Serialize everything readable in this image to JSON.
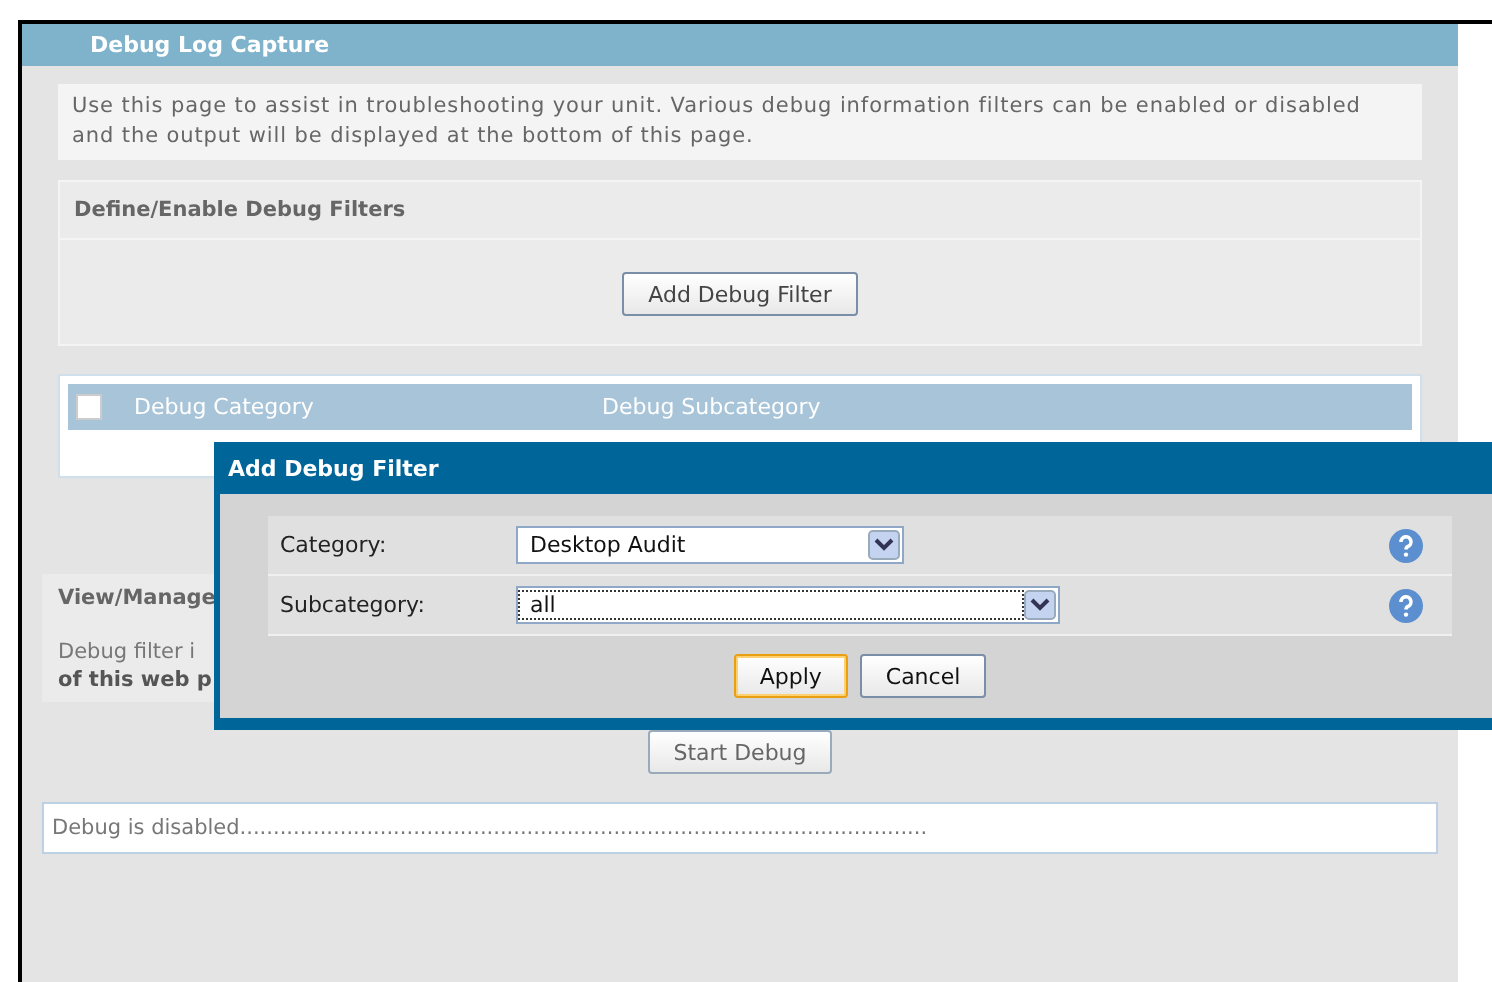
{
  "page_title": "Debug Log Capture",
  "intro": "Use this page to assist in troubleshooting your unit. Various debug information filters can be enabled or disabled and the output will be displayed at the bottom of this page.",
  "filters_section": {
    "title": "Define/Enable Debug Filters",
    "add_button": "Add Debug Filter"
  },
  "filter_table": {
    "select_all_checked": false,
    "columns": [
      "Debug Category",
      "Debug Subcategory"
    ]
  },
  "manage_section": {
    "title": "View/Manage",
    "text": "Debug filter i",
    "text_bold": "of this web p"
  },
  "start_button": "Start Debug",
  "log_output": "Debug is disabled.......................................................................................................",
  "dialog": {
    "title": "Add Debug Filter",
    "fields": [
      {
        "label": "Category:",
        "value": "Desktop Audit",
        "focused": false
      },
      {
        "label": "Subcategory:",
        "value": "all",
        "focused": true
      }
    ],
    "buttons": [
      {
        "label": "Apply",
        "selected": true
      },
      {
        "label": "Cancel",
        "selected": false
      }
    ]
  }
}
